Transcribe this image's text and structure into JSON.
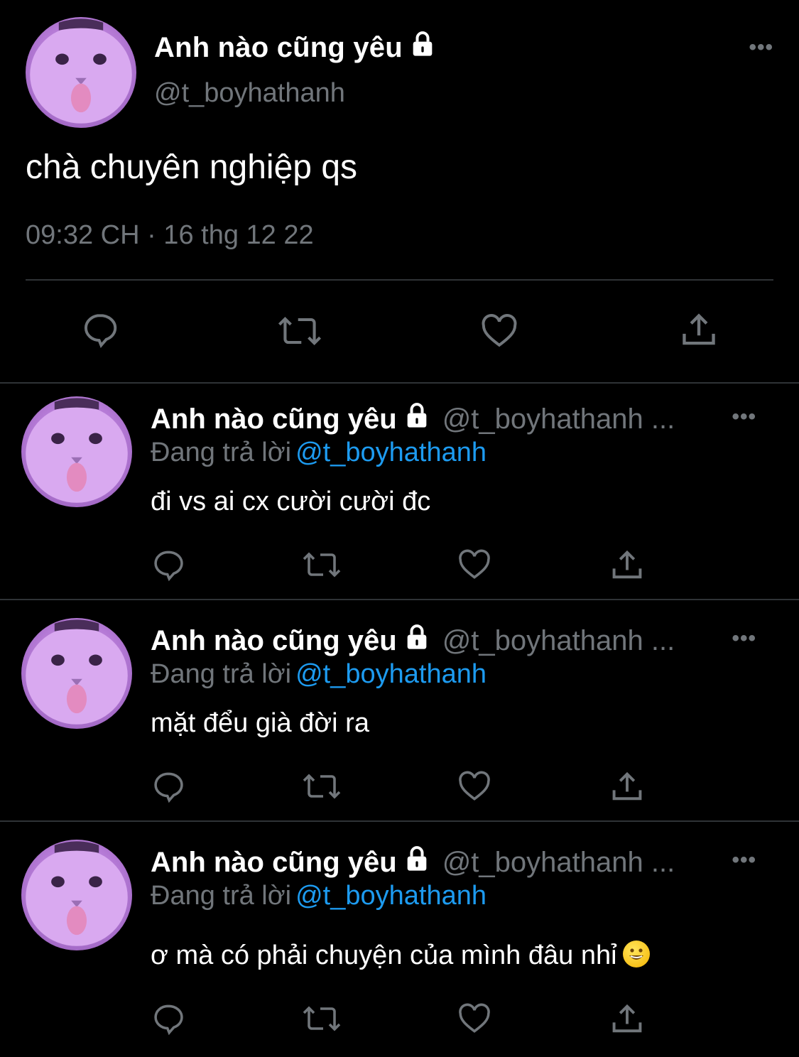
{
  "main_tweet": {
    "display_name": "Anh nào cũng yêu",
    "handle": "@t_boyhathanh",
    "text": "chà chuyên nghiệp qs",
    "timestamp": "09:32 CH · 16 thg 12 22",
    "more_label": "•••"
  },
  "replies": [
    {
      "display_name": "Anh nào cũng yêu",
      "handle": "@t_boyhathanh ...",
      "replying_prefix": "Đang trả lời",
      "replying_to": "@t_boyhathanh",
      "text": "đi vs ai cx cười cười đc",
      "more_label": "•••"
    },
    {
      "display_name": "Anh nào cũng yêu",
      "handle": "@t_boyhathanh ...",
      "replying_prefix": "Đang trả lời",
      "replying_to": "@t_boyhathanh",
      "text": "mặt đểu già đời ra",
      "more_label": "•••"
    },
    {
      "display_name": "Anh nào cũng yêu",
      "handle": "@t_boyhathanh ...",
      "replying_prefix": "Đang trả lời",
      "replying_to": "@t_boyhathanh",
      "text": "ơ mà có phải chuyện của mình đâu nhỉ",
      "more_label": "•••",
      "emoji": "smiley-emoji"
    }
  ],
  "icons": {
    "reply": "reply-icon",
    "retweet": "retweet-icon",
    "like": "heart-icon",
    "share": "share-icon",
    "lock": "lock-icon"
  },
  "colors": {
    "background": "#000000",
    "text": "#ffffff",
    "secondary": "#71767b",
    "mention": "#1d9bf0",
    "divider": "#2f3336",
    "avatar_tint": "#c08ae0"
  }
}
